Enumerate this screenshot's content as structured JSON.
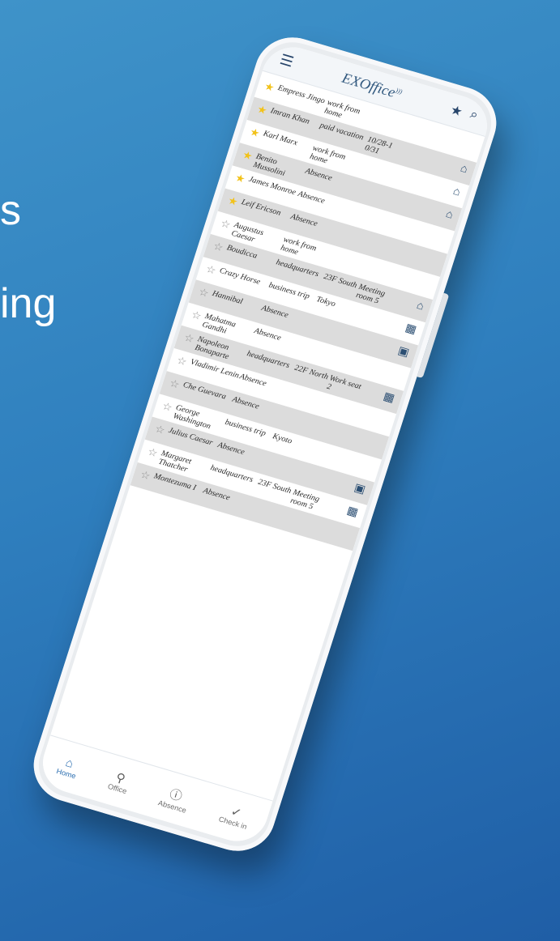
{
  "slide": {
    "text_1": "s",
    "text_2": "ing"
  },
  "header": {
    "app_name": "EXOffice"
  },
  "rows": [
    {
      "fav": true,
      "name": "Empress Jingo",
      "status": "work from home",
      "loc": "",
      "place": "",
      "icon": ""
    },
    {
      "fav": true,
      "name": "Imran Khan",
      "status": "paid vacation",
      "loc": "10/28-1 0/31",
      "place": "",
      "icon": "home-icon"
    },
    {
      "fav": true,
      "name": "Karl Marx",
      "status": "work from home",
      "loc": "",
      "place": "",
      "icon": "home-icon"
    },
    {
      "fav": true,
      "name": "Benito Mussolini",
      "status": "Absence",
      "loc": "",
      "place": "",
      "icon": "home-icon"
    },
    {
      "fav": true,
      "name": "James Monroe",
      "status": "Absence",
      "loc": "",
      "place": "",
      "icon": ""
    },
    {
      "fav": true,
      "name": "Leif Ericson",
      "status": "Absence",
      "loc": "",
      "place": "",
      "icon": ""
    },
    {
      "fav": false,
      "name": "Augustus Caesar",
      "status": "work from home",
      "loc": "",
      "place": "",
      "icon": ""
    },
    {
      "fav": false,
      "name": "Boudicca",
      "status": "headquarters",
      "loc": "23F South",
      "place": "Meeting room 5",
      "icon": "home-icon"
    },
    {
      "fav": false,
      "name": "Crazy Horse",
      "status": "business trip",
      "loc": "Tokyo",
      "place": "",
      "icon": "building-icon"
    },
    {
      "fav": false,
      "name": "Hannibal",
      "status": "Absence",
      "loc": "",
      "place": "",
      "icon": "briefcase-icon"
    },
    {
      "fav": false,
      "name": "Mahatma Gandhi",
      "status": "Absence",
      "loc": "",
      "place": "",
      "icon": ""
    },
    {
      "fav": false,
      "name": "Napoleon Bonaparte",
      "status": "headquarters",
      "loc": "22F North",
      "place": "Work seat 2",
      "icon": "building-icon"
    },
    {
      "fav": false,
      "name": "Vladimir Lenin",
      "status": "Absence",
      "loc": "",
      "place": "",
      "icon": ""
    },
    {
      "fav": false,
      "name": "Che Guevara",
      "status": "Absence",
      "loc": "",
      "place": "",
      "icon": ""
    },
    {
      "fav": false,
      "name": "George Washington",
      "status": "business trip",
      "loc": "Kyoto",
      "place": "",
      "icon": ""
    },
    {
      "fav": false,
      "name": "Julius Caesar",
      "status": "Absence",
      "loc": "",
      "place": "",
      "icon": "briefcase-icon"
    },
    {
      "fav": false,
      "name": "Margaret Thatcher",
      "status": "headquarters",
      "loc": "23F South",
      "place": "Meeting room 5",
      "icon": "building-icon"
    },
    {
      "fav": false,
      "name": "Montezuma I",
      "status": "Absence",
      "loc": "",
      "place": "",
      "icon": ""
    }
  ],
  "tabs": [
    {
      "label": "Home",
      "icon": "home-icon",
      "active": true
    },
    {
      "label": "Office",
      "icon": "location-pin-icon",
      "active": false
    },
    {
      "label": "Absence",
      "icon": "info-circle-icon",
      "active": false
    },
    {
      "label": "Check in",
      "icon": "checkmark-icon",
      "active": false
    }
  ],
  "colors": {
    "background": "#2f7fbe",
    "header": "#27456b",
    "star": "#f2c21a",
    "row_alt": "#dcdcdc",
    "active_tab": "#2c6fb1"
  }
}
